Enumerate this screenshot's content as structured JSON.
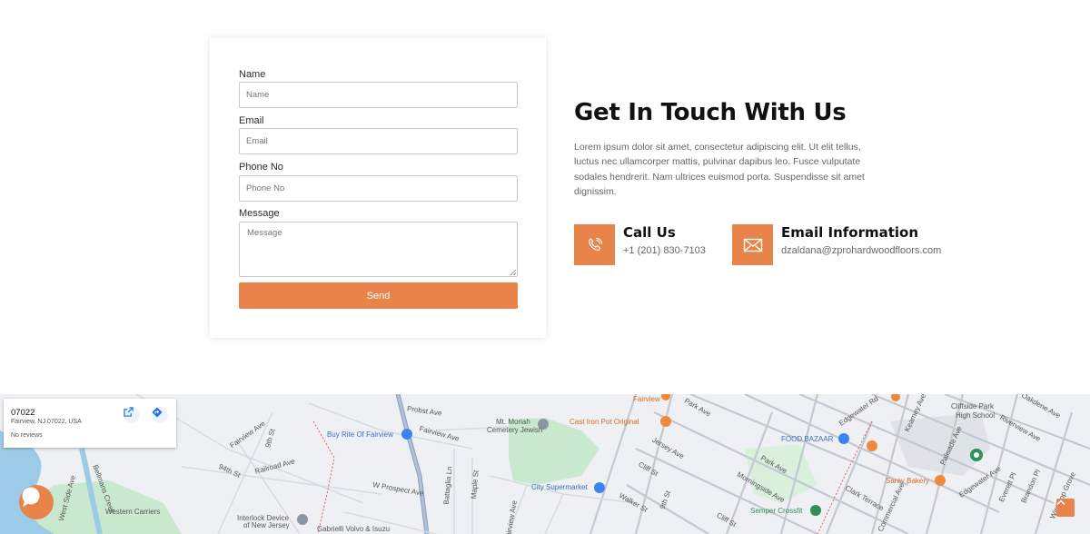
{
  "form": {
    "name_label": "Name",
    "name_placeholder": "Name",
    "email_label": "Email",
    "email_placeholder": "Email",
    "phone_label": "Phone No",
    "phone_placeholder": "Phone No",
    "message_label": "Message",
    "message_placeholder": "Message",
    "send_label": "Send"
  },
  "contact": {
    "title": "Get In Touch With Us",
    "description": "Lorem ipsum dolor sit amet, consectetur adipiscing elit. Ut elit tellus, luctus nec ullamcorper mattis, pulvinar dapibus leo. Fusce vulputate sodales hendrerit. Nam ultrices euismod porta. Suspendisse sit amet dignissim.",
    "call_title": "Call Us",
    "call_value": "+1 (201) 830-7103",
    "email_title": "Email Information",
    "email_value": "dzaldana@zprohardwoodfloors.com",
    "call_icon": "phone-icon",
    "email_icon": "envelope-icon"
  },
  "map": {
    "place_name": "07022",
    "place_address": "Fairview, NJ 07022, USA",
    "place_reviews": "No reviews",
    "labels": {
      "fairview": "Fairview",
      "park_ave": "Park Ave",
      "edgewater_rd": "Edgewater Rd",
      "kearney_ave": "Kearney Ave",
      "cliffside_park": "Cliffside Park",
      "high_school": "High School",
      "oakdene_ave": "Oakdene Ave",
      "riverview_ave": "Riverview Ave",
      "probst_ave": "Probst Ave",
      "mt_moriah": "Mt. Moriah",
      "cemetery_jewish": "Cemetery Jewish",
      "cast_iron_pot": "Cast Iron Pot Original",
      "buy_rite": "Buy Rite Of Fairview",
      "fairview_ave": "Fairview Ave",
      "fairview_ave_2": "Fairview Ave",
      "jersey_ave": "Jersey Ave",
      "food_bazaar": "FOOD BAZAAR",
      "palisade_ave": "Palisade Ave",
      "park_ave_2": "Park Ave",
      "saray_bakery": "Saray Bakery",
      "edgewater_ave": "Edgewater Ave",
      "everett_pl": "Everett Pl",
      "brandon_pl": "Brandon Pl",
      "winthrop_grove": "Winthrop Grove",
      "ninth_st": "9th St",
      "ninety_fourth_st": "94th St",
      "railroad_ave": "Railroad Ave",
      "w_prospect_ave": "W Prospect Ave",
      "battaglia_ln": "Battaglia Ln",
      "maple_st": "Maple St",
      "city_supermarket": "City Supermarket",
      "cliff_st": "Cliff St",
      "cliff_st_2": "Cliff St",
      "morningside_ave": "Morningside Ave",
      "clark_terrace": "Clark Terrace",
      "walker_st": "Walker St",
      "ninth_st_2": "9th St",
      "semper_crossfit": "Semper Crossfit",
      "commercial_ave": "Commercial Ave",
      "western_carriers": "Western Carriers",
      "interlock_device": "Interlock Device",
      "of_new_jersey": "of New Jersey",
      "gabrielli_volvo": "Gabrielli Volvo & Isuzu",
      "belmans_creek": "Bellmans Creek",
      "w_side_ave": "West Side Ave",
      "fairview_ave_3": "Fairview Ave"
    }
  },
  "colors": {
    "accent": "#e8834a",
    "title": "#111111",
    "text": "#666666"
  }
}
